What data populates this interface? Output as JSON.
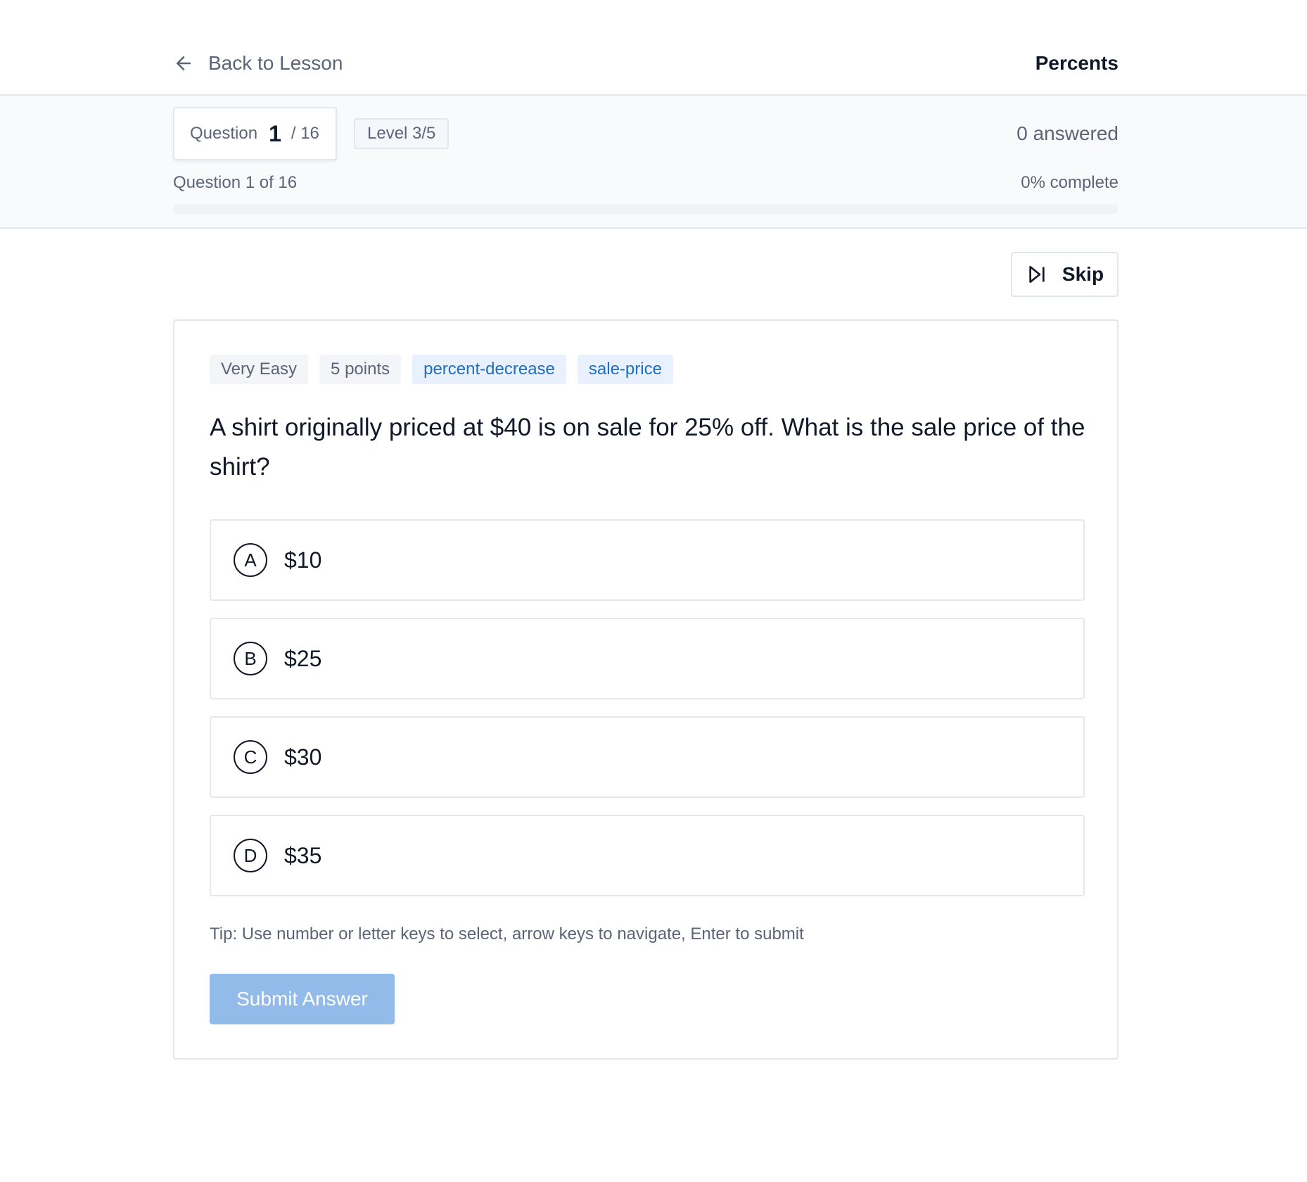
{
  "header": {
    "back_label": "Back to Lesson",
    "lesson_title": "Percents"
  },
  "progress": {
    "question_label": "Question",
    "current": "1",
    "total": "/ 16",
    "level": "Level 3/5",
    "answered": "0 answered",
    "question_of": "Question 1 of 16",
    "percent_complete": "0% complete",
    "fraction_complete": 0
  },
  "skip_label": "Skip",
  "question": {
    "tags": [
      {
        "label": "Very Easy",
        "style": "gray"
      },
      {
        "label": "5 points",
        "style": "gray"
      },
      {
        "label": "percent-decrease",
        "style": "blue"
      },
      {
        "label": "sale-price",
        "style": "blue"
      }
    ],
    "text": "A shirt originally priced at $40 is on sale for 25% off. What is the sale price of the shirt?",
    "options": [
      {
        "letter": "A",
        "text": "$10"
      },
      {
        "letter": "B",
        "text": "$25"
      },
      {
        "letter": "C",
        "text": "$30"
      },
      {
        "letter": "D",
        "text": "$35"
      }
    ],
    "tip": "Tip: Use number or letter keys to select, arrow keys to navigate, Enter to submit",
    "submit_label": "Submit Answer"
  },
  "colors": {
    "tag_blue_text": "#1d6fc4",
    "tag_blue_bg": "#e8f1fd",
    "submit_disabled": "#93bbea"
  },
  "icons": {
    "back": "arrow-left-icon",
    "skip": "skip-forward-icon"
  }
}
